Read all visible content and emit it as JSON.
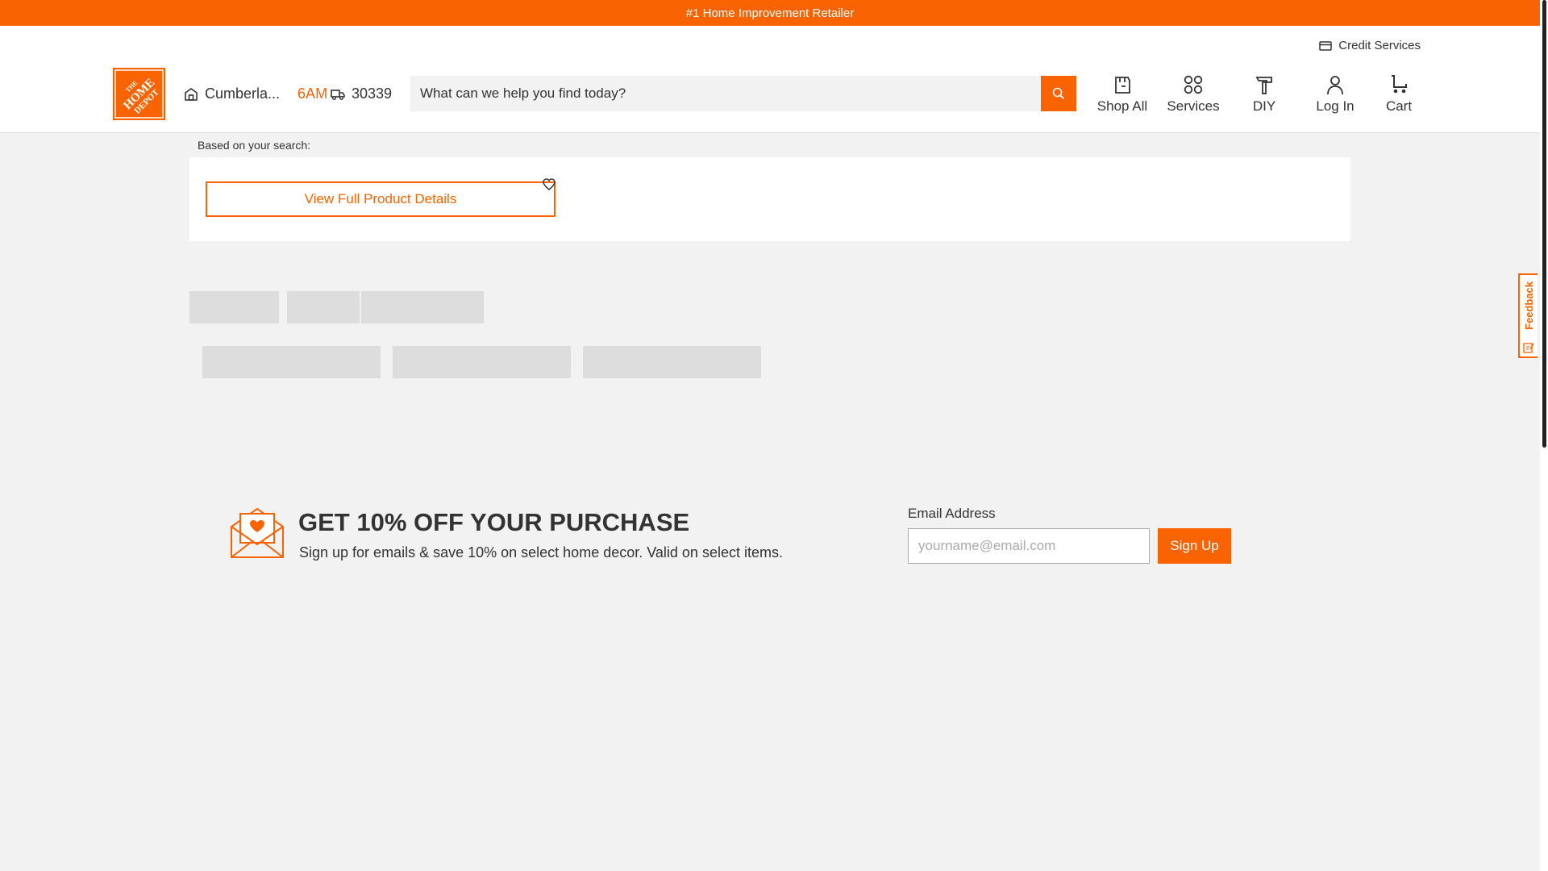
{
  "topbar": {
    "tagline": "#1 Home Improvement Retailer"
  },
  "header": {
    "credit_services": "Credit Services",
    "logo_text": "THE HOME DEPOT",
    "store_name": "Cumberla...",
    "store_hours": "6AM",
    "zip": "30339",
    "search_placeholder": "What can we help you find today?",
    "nav": [
      {
        "label": "Shop All",
        "icon": "shop-all-icon"
      },
      {
        "label": "Services",
        "icon": "services-icon"
      },
      {
        "label": "DIY",
        "icon": "hammer-icon"
      },
      {
        "label": "Log In",
        "icon": "user-icon"
      },
      {
        "label": "Cart",
        "icon": "cart-icon"
      }
    ]
  },
  "product": {
    "based_on": "Based on your search:",
    "view_details": "View Full Product Details"
  },
  "promo": {
    "title": "GET 10% OFF YOUR PURCHASE",
    "subtitle": "Sign up for emails & save 10% on select home decor. Valid on select items.",
    "email_label": "Email Address",
    "email_placeholder": "yourname@email.com",
    "signup_label": "Sign Up"
  },
  "feedback": {
    "label": "Feedback"
  },
  "colors": {
    "brand": "#f96302",
    "background": "#f2f2f2",
    "skeleton": "#dddddd"
  }
}
